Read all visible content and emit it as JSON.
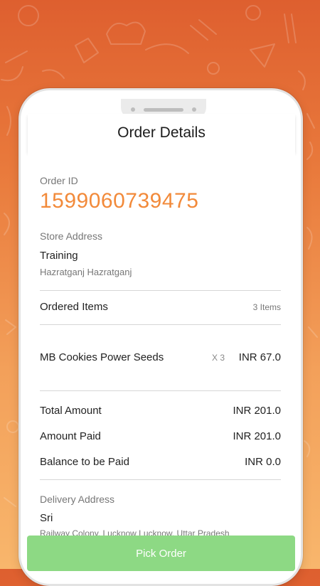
{
  "header": {
    "title": "Order Details"
  },
  "order": {
    "id_label": "Order ID",
    "id_value": "1599060739475",
    "store_label": "Store Address",
    "store_name": "Training",
    "store_address": "Hazratganj Hazratganj"
  },
  "items": {
    "heading": "Ordered Items",
    "count_text": "3 Items",
    "list": [
      {
        "name": "MB Cookies Power Seeds",
        "qty": "X 3",
        "price": "INR 67.0"
      }
    ]
  },
  "totals": {
    "total_label": "Total Amount",
    "total_value": "INR 201.0",
    "paid_label": "Amount Paid",
    "paid_value": "INR 201.0",
    "balance_label": "Balance to be Paid",
    "balance_value": "INR 0.0"
  },
  "delivery": {
    "label": "Delivery Address",
    "name": "Sri",
    "address": "Railway Colony, Lucknow Lucknow, Uttar Pradesh"
  },
  "actions": {
    "pick_label": "Pick Order"
  },
  "colors": {
    "accent": "#f28a3a",
    "button": "#8dd984",
    "bg_top": "#de5f2f",
    "bg_bottom": "#f8b66c"
  },
  "icons": [
    "food-doodle-background"
  ]
}
